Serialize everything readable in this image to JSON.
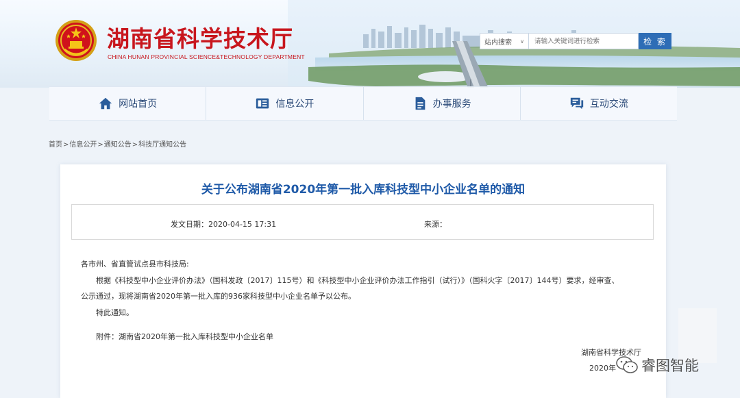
{
  "header": {
    "title": "湖南省科学技术厅",
    "subtitle": "CHINA HUNAN PROVINCIAL SCIENCE&TECHNOLOGY DEPARTMENT"
  },
  "search": {
    "scope": "站内搜索",
    "placeholder": "请输入关键词进行检索",
    "button_label": "检 索"
  },
  "nav": {
    "items": [
      {
        "label": "网站首页",
        "icon": "home-icon"
      },
      {
        "label": "信息公开",
        "icon": "info-list-icon"
      },
      {
        "label": "办事服务",
        "icon": "document-icon"
      },
      {
        "label": "互动交流",
        "icon": "chat-icon"
      }
    ]
  },
  "breadcrumb": {
    "items": [
      "首页",
      "信息公开",
      "通知公告",
      "科技厅通知公告"
    ],
    "separator": ">"
  },
  "article": {
    "title": "关于公布湖南省2020年第一批入库科技型中小企业名单的通知",
    "date_label": "发文日期：",
    "date_value": "2020-04-15 17:31",
    "source_label": "来源：",
    "salutation": "各市州、省直管试点县市科技局:",
    "paragraph1": "根据《科技型中小企业评价办法》（国科发政〔2017〕115号）和《科技型中小企业评价办法工作指引（试行）》（国科火字〔2017〕144号）要求，经审查、",
    "paragraph2": "公示通过，现将湖南省2020年第一批入库的936家科技型中小企业名单予以公布。",
    "closing": "特此通知。",
    "attachment": "附件：湖南省2020年第一批入库科技型中小企业名单",
    "signature": "湖南省科学技术厅",
    "sign_date": "2020年"
  },
  "watermark": {
    "text": "睿图智能"
  },
  "colors": {
    "brand_red": "#c8161d",
    "nav_text": "#2b4a78",
    "title_blue": "#1f5aa8",
    "button_blue": "#2e6db6"
  }
}
